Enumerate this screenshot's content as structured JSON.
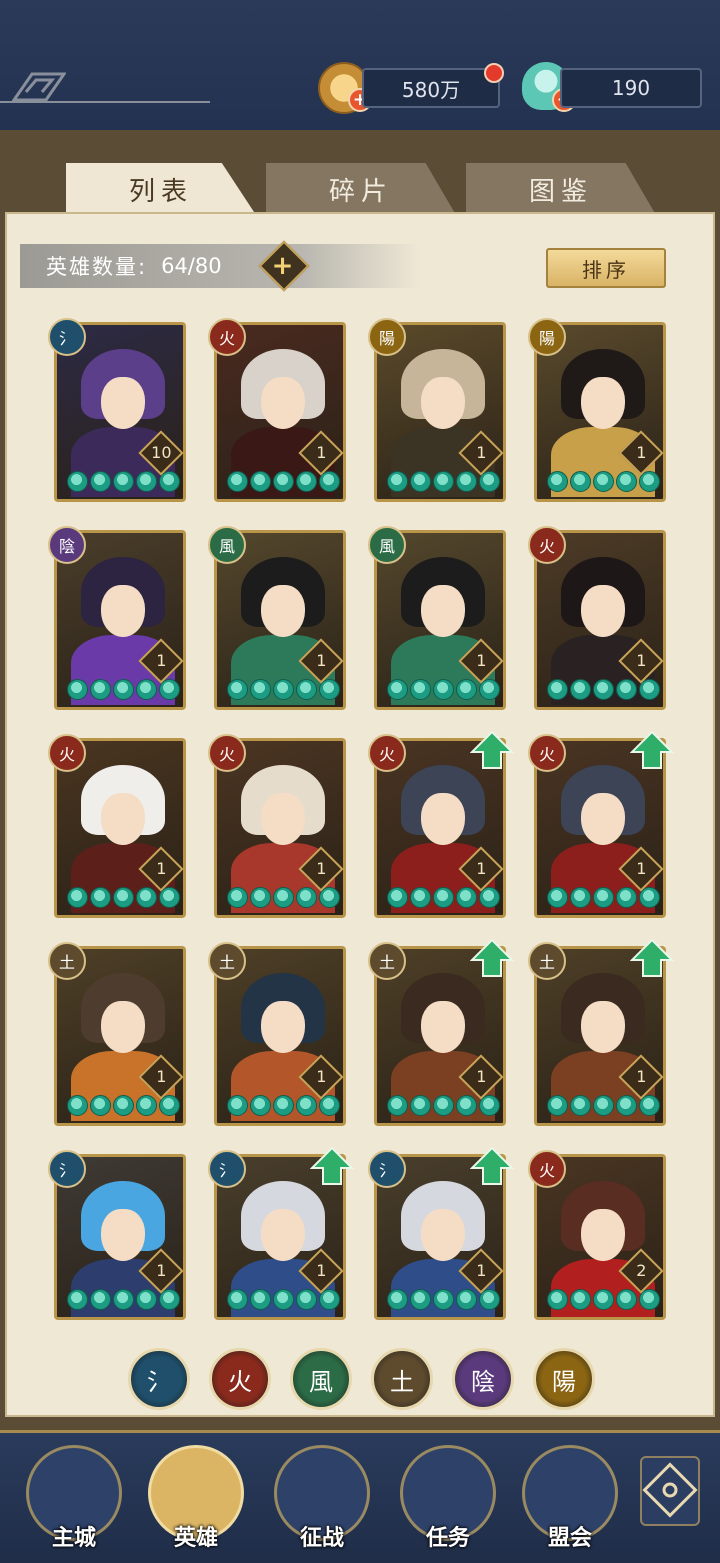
{
  "header": {
    "coins": "580万",
    "gems": "190"
  },
  "tabs": [
    {
      "label": "列表",
      "active": true
    },
    {
      "label": "碎片",
      "active": false
    },
    {
      "label": "图鉴",
      "active": false
    }
  ],
  "hero_count": {
    "label": "英雄数量:",
    "value": "64/80"
  },
  "sort_label": "排序",
  "colors": {
    "water": "#1f4f6b",
    "fire": "#8a2a1c",
    "wind": "#2b6b45",
    "earth": "#5e4b2e",
    "yin": "#5a3a7c",
    "yang": "#8b6512",
    "star": "#1c9c83",
    "gold": "#b99549"
  },
  "heroes": [
    {
      "element": "water",
      "element_glyph": "氵",
      "level": "10",
      "stars": 5,
      "upgrade": false,
      "hair": "#5b3f8a",
      "body": "#3c2b5a",
      "bg": "#2d2a45"
    },
    {
      "element": "fire",
      "element_glyph": "火",
      "level": "1",
      "stars": 5,
      "upgrade": false,
      "hair": "#d9d2ca",
      "body": "#3a1816",
      "bg": "#4a2a20"
    },
    {
      "element": "yang",
      "element_glyph": "陽",
      "level": "1",
      "stars": 5,
      "upgrade": false,
      "hair": "#c7b59a",
      "body": "#3b3424",
      "bg": "#5b4a2a"
    },
    {
      "element": "yang",
      "element_glyph": "陽",
      "level": "1",
      "stars": 5,
      "upgrade": false,
      "hair": "#1f1a18",
      "body": "#c9a04a",
      "bg": "#5a4a2c"
    },
    {
      "element": "yin",
      "element_glyph": "陰",
      "level": "1",
      "stars": 5,
      "upgrade": false,
      "hair": "#2c2440",
      "body": "#6a3aa8",
      "bg": "#4a3d2a"
    },
    {
      "element": "wind",
      "element_glyph": "風",
      "level": "1",
      "stars": 5,
      "upgrade": false,
      "hair": "#1d1c1c",
      "body": "#2d7a5a",
      "bg": "#54472c"
    },
    {
      "element": "wind",
      "element_glyph": "風",
      "level": "1",
      "stars": 5,
      "upgrade": false,
      "hair": "#1d1c1c",
      "body": "#2d7a5a",
      "bg": "#54472c"
    },
    {
      "element": "fire",
      "element_glyph": "火",
      "level": "1",
      "stars": 5,
      "upgrade": false,
      "hair": "#1d1717",
      "body": "#2a2222",
      "bg": "#4d3b26"
    },
    {
      "element": "fire",
      "element_glyph": "火",
      "level": "1",
      "stars": 5,
      "upgrade": false,
      "hair": "#f0eeea",
      "body": "#5c1f1a",
      "bg": "#4a3520"
    },
    {
      "element": "fire",
      "element_glyph": "火",
      "level": "1",
      "stars": 5,
      "upgrade": false,
      "hair": "#e6dccc",
      "body": "#a8382b",
      "bg": "#4c3522"
    },
    {
      "element": "fire",
      "element_glyph": "火",
      "level": "1",
      "stars": 5,
      "upgrade": true,
      "hair": "#3c4456",
      "body": "#8c1f1c",
      "bg": "#4a3422"
    },
    {
      "element": "fire",
      "element_glyph": "火",
      "level": "1",
      "stars": 5,
      "upgrade": true,
      "hair": "#3c4456",
      "body": "#8c1f1c",
      "bg": "#4a3422"
    },
    {
      "element": "earth",
      "element_glyph": "土",
      "level": "1",
      "stars": 5,
      "upgrade": false,
      "hair": "#4e3c2e",
      "body": "#c8722a",
      "bg": "#4e3f26"
    },
    {
      "element": "earth",
      "element_glyph": "土",
      "level": "1",
      "stars": 5,
      "upgrade": false,
      "hair": "#233446",
      "body": "#b3562a",
      "bg": "#4e3f26"
    },
    {
      "element": "earth",
      "element_glyph": "土",
      "level": "1",
      "stars": 5,
      "upgrade": true,
      "hair": "#3b2a20",
      "body": "#7b3f22",
      "bg": "#4e3f26"
    },
    {
      "element": "earth",
      "element_glyph": "土",
      "level": "1",
      "stars": 5,
      "upgrade": true,
      "hair": "#3b2a20",
      "body": "#7b3f22",
      "bg": "#4e3f26"
    },
    {
      "element": "water",
      "element_glyph": "氵",
      "level": "1",
      "stars": 5,
      "upgrade": false,
      "hair": "#4aa6e0",
      "body": "#2c3d6e",
      "bg": "#3e3a34"
    },
    {
      "element": "water",
      "element_glyph": "氵",
      "level": "1",
      "stars": 5,
      "upgrade": true,
      "hair": "#d6d8e0",
      "body": "#2f4d88",
      "bg": "#4a3f2c"
    },
    {
      "element": "water",
      "element_glyph": "氵",
      "level": "1",
      "stars": 5,
      "upgrade": true,
      "hair": "#d6d8e0",
      "body": "#2f4d88",
      "bg": "#4a3f2c"
    },
    {
      "element": "fire",
      "element_glyph": "火",
      "level": "2",
      "stars": 5,
      "upgrade": false,
      "hair": "#5a2d22",
      "body": "#b21f1f",
      "bg": "#4a3522"
    }
  ],
  "element_filters": [
    {
      "key": "water",
      "glyph": "氵"
    },
    {
      "key": "fire",
      "glyph": "火"
    },
    {
      "key": "wind",
      "glyph": "風"
    },
    {
      "key": "earth",
      "glyph": "土"
    },
    {
      "key": "yin",
      "glyph": "陰"
    },
    {
      "key": "yang",
      "glyph": "陽"
    }
  ],
  "nav": [
    {
      "label": "主城",
      "active": false
    },
    {
      "label": "英雄",
      "active": true
    },
    {
      "label": "征战",
      "active": false
    },
    {
      "label": "任务",
      "active": false
    },
    {
      "label": "盟会",
      "active": false
    }
  ]
}
